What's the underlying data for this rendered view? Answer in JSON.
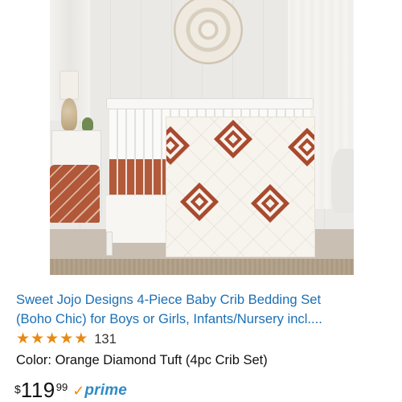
{
  "product": {
    "image_alt": "Boho crib bedding set in nursery",
    "title_line1": "Sweet Jojo Designs 4-Piece Baby Crib Bedding Set",
    "title_line2": "(Boho Chic) for Boys or Girls, Infants/Nursery incl....",
    "rating": {
      "stars": 5,
      "star_glyph": "★",
      "review_count": "131"
    },
    "color_line": "Color: Orange Diamond Tuft (4pc Crib Set)",
    "price": {
      "currency": "$",
      "whole": "119",
      "fraction": "99"
    },
    "prime": {
      "check": "✓",
      "label": "prime"
    }
  },
  "colors": {
    "link_blue": "#1b6fb5",
    "star_orange": "#e78a13",
    "prime_blue": "#2f8ac6",
    "rust": "#a94a2f"
  }
}
